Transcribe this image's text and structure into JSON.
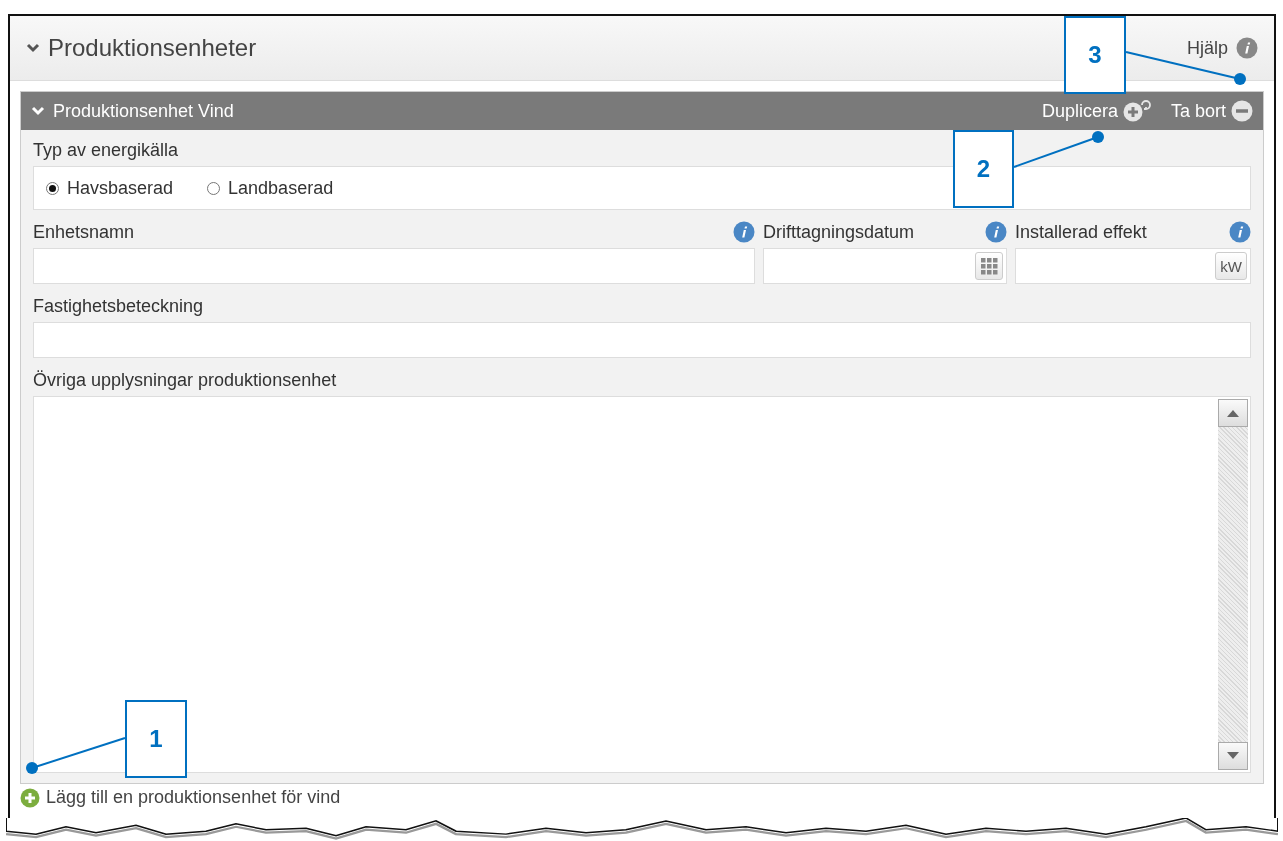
{
  "section": {
    "title": "Produktionsenheter",
    "expanded": true,
    "help": "Hjälp"
  },
  "unit": {
    "title": "Produktionsenhet Vind",
    "expanded": true,
    "actions": [
      {
        "kind": "duplicate",
        "label": "Duplicera"
      },
      {
        "kind": "remove",
        "label": "Ta bort"
      }
    ],
    "energy_type": {
      "label": "Typ av energikälla",
      "options": [
        {
          "label": "Havsbaserad",
          "selected": true
        },
        {
          "label": "Landbaserad",
          "selected": false
        }
      ]
    },
    "fields": [
      {
        "kind": "text",
        "label": "Enhetsnamn"
      },
      {
        "kind": "date",
        "label": "Drifttagningsdatum"
      },
      {
        "kind": "unit",
        "label": "Installerad effekt",
        "unit": "kW"
      }
    ],
    "property": {
      "label": "Fastighetsbeteckning"
    },
    "notes": {
      "label": "Övriga upplysningar produktionsenhet"
    }
  },
  "add_link": "Lägg till en produktionsenhet för vind",
  "callouts": [
    {
      "label": "1"
    },
    {
      "label": "2"
    },
    {
      "label": "3"
    }
  ]
}
